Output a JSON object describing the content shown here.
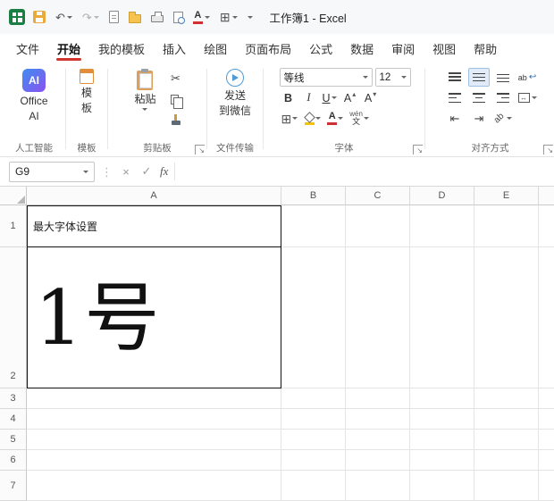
{
  "titlebar": {
    "title": "工作簿1 - Excel"
  },
  "quick_access": {
    "font_color_letter": "A"
  },
  "tabs": [
    {
      "label": "文件"
    },
    {
      "label": "开始",
      "active": true
    },
    {
      "label": "我的模板"
    },
    {
      "label": "插入"
    },
    {
      "label": "绘图"
    },
    {
      "label": "页面布局"
    },
    {
      "label": "公式"
    },
    {
      "label": "数据"
    },
    {
      "label": "审阅"
    },
    {
      "label": "视图"
    },
    {
      "label": "帮助"
    }
  ],
  "ribbon": {
    "ai": {
      "badge": "AI",
      "label_line1": "Office",
      "label_line2": "AI",
      "group": "人工智能"
    },
    "template": {
      "label_line1": "模",
      "label_line2": "板",
      "group": "模板"
    },
    "clipboard": {
      "paste": "粘贴",
      "group": "剪贴板"
    },
    "wechat": {
      "label_line1": "发送",
      "label_line2": "到微信",
      "group": "文件传输"
    },
    "font": {
      "family": "等线",
      "size": "12",
      "bold": "B",
      "italic": "I",
      "underline": "U",
      "grow_letter": "A",
      "shrink_letter": "A",
      "color_letter": "A",
      "phonetic_top": "wén",
      "phonetic_bottom": "文",
      "group": "字体"
    },
    "align": {
      "wrap_label": "ab",
      "orientation_label": "ab",
      "group": "对齐方式"
    }
  },
  "formula_bar": {
    "name_box": "G9",
    "formula": ""
  },
  "sheet": {
    "columns": [
      "A",
      "B",
      "C",
      "D",
      "E"
    ],
    "rows": [
      "1",
      "2",
      "3",
      "4",
      "5",
      "6",
      "7"
    ],
    "cells": {
      "A1": "最大字体设置",
      "A2": "1号"
    }
  },
  "glyphs": {
    "undo": "↶",
    "redo": "↷",
    "scissors": "✂",
    "dots": "⋮",
    "cancel": "×",
    "enter": "✓",
    "fx": "fx",
    "borders_grid": "⊞",
    "merge_arrows": "↔",
    "wrap_return": "↩",
    "indent_left": "⇤",
    "indent_right": "⇥",
    "launcher": "↘",
    "caret_up": "▴",
    "caret_down": "▾"
  },
  "colors": {
    "accent": "#d0342c",
    "excel_green": "#1a7f43",
    "save_yellow": "#e9a93b",
    "font_color_bar": "#d23030",
    "fill_color_bar": "#f2c500"
  }
}
